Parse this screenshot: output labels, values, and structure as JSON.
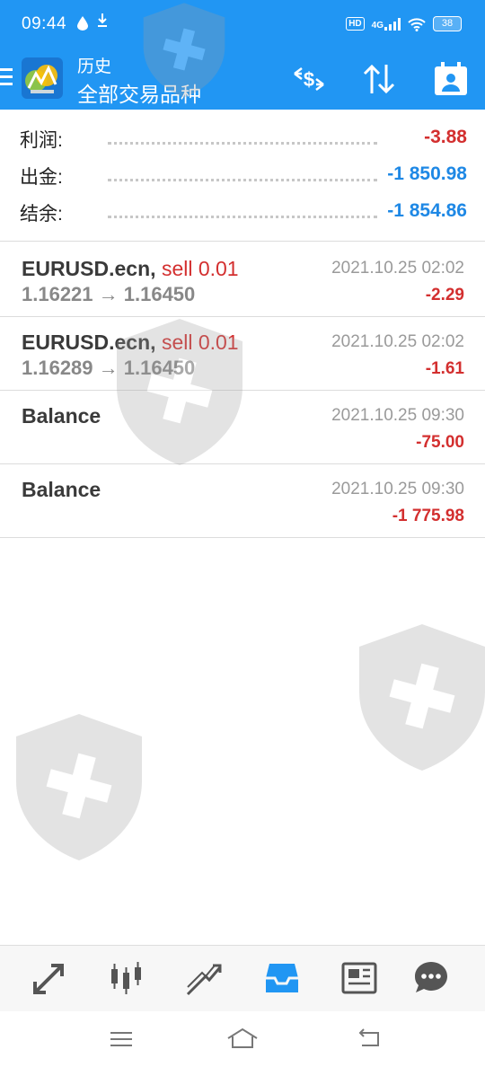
{
  "status_bar": {
    "time": "09:44",
    "network": "4G",
    "hd": "HD",
    "battery": "38",
    "icons": [
      "drop-icon",
      "download-icon",
      "signal-icon",
      "wifi-icon",
      "battery-icon"
    ]
  },
  "app_bar": {
    "subtitle": "历史",
    "title": "全部交易品种",
    "actions": [
      "exchange-dollar-icon",
      "sort-icon",
      "calendar-person-icon"
    ]
  },
  "summary": {
    "rows": [
      {
        "label": "利润:",
        "value": "-3.88",
        "color": "#d32f2f"
      },
      {
        "label": "出金:",
        "value": "-1 850.98",
        "color": "#1e88e5"
      },
      {
        "label": "结余:",
        "value": "-1 854.86",
        "color": "#1e88e5"
      }
    ]
  },
  "history": [
    {
      "symbol": "EURUSD.ecn,",
      "type": "sell 0.01",
      "prices": "1.16221 → 1.16450",
      "time": "2021.10.25 02:02",
      "profit": "-2.29"
    },
    {
      "symbol": "EURUSD.ecn,",
      "type": "sell 0.01",
      "prices": "1.16289 → 1.16450",
      "time": "2021.10.25 02:02",
      "profit": "-1.61"
    },
    {
      "symbol": "Balance",
      "type": "",
      "prices": "",
      "time": "2021.10.25 09:30",
      "profit": "-75.00"
    },
    {
      "symbol": "Balance",
      "type": "",
      "prices": "",
      "time": "2021.10.25 09:30",
      "profit": "-1 775.98"
    }
  ],
  "bottom_nav": {
    "items": [
      "quotes-icon",
      "chart-icon",
      "trade-icon",
      "history-icon",
      "news-icon",
      "chat-icon"
    ],
    "active": "history-icon",
    "active_color": "#2196f3"
  },
  "system_nav": [
    "menu-icon",
    "home-icon",
    "back-icon"
  ]
}
